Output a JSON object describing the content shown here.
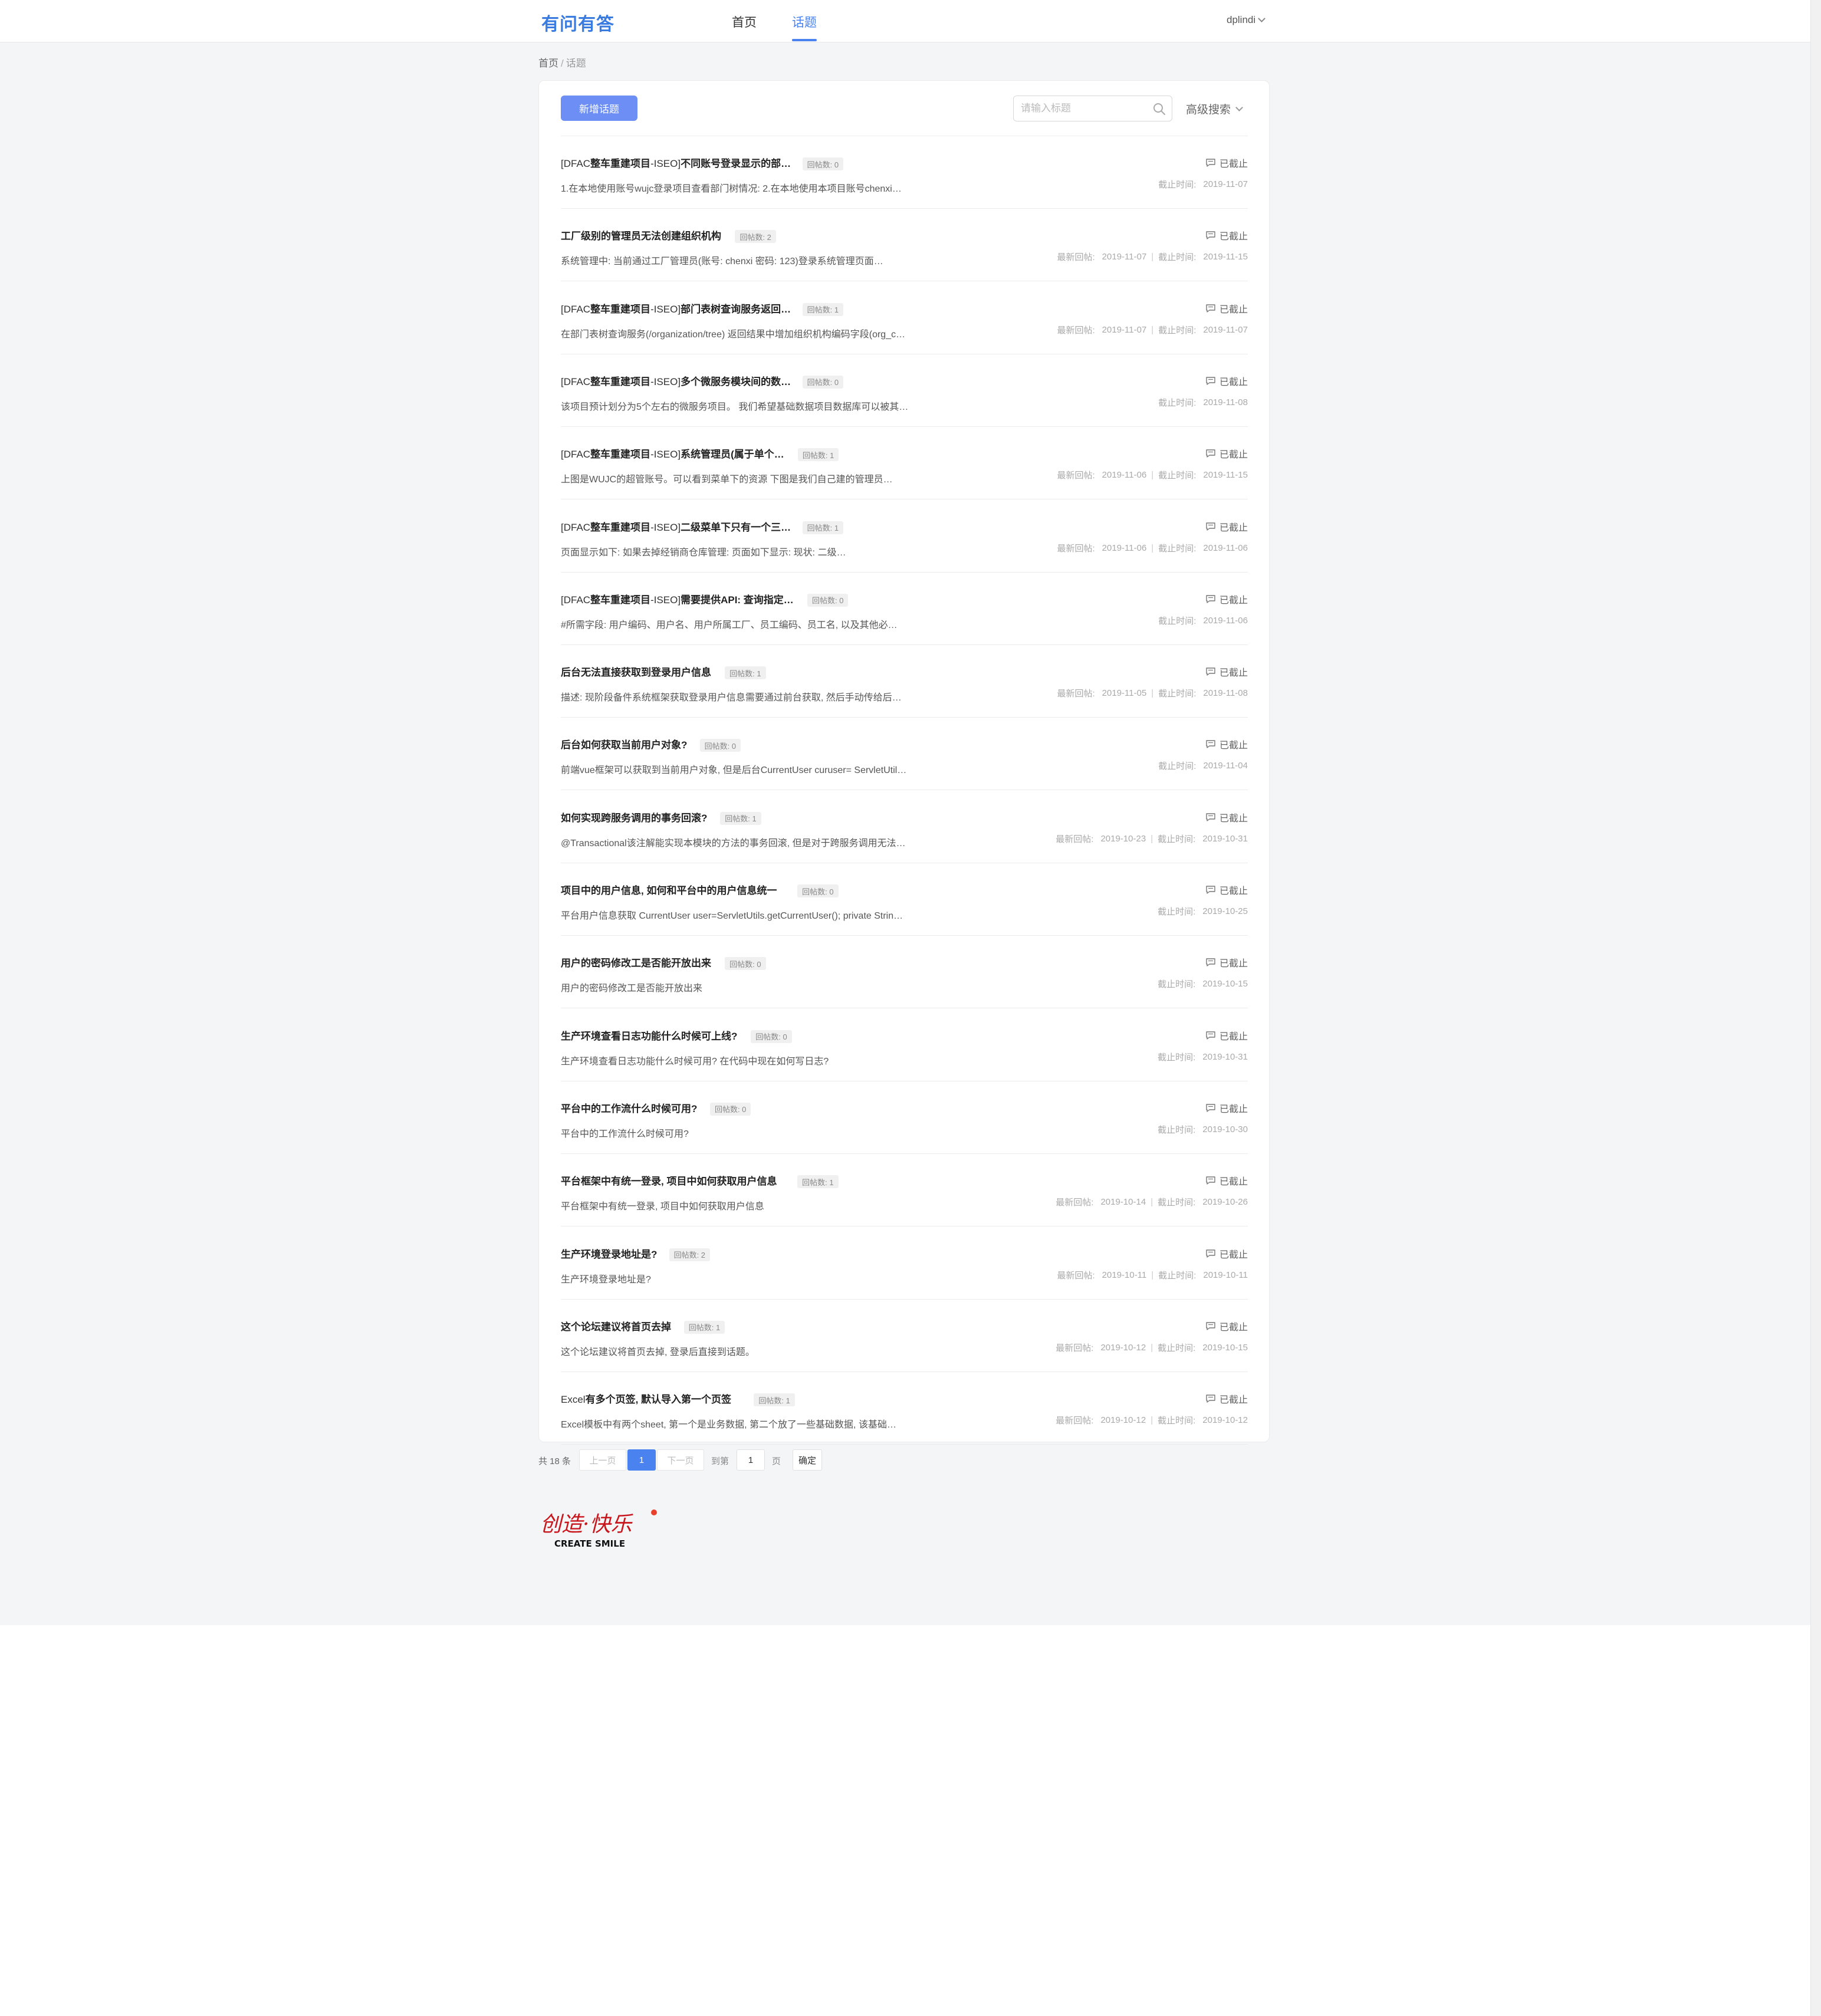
{
  "header": {
    "logo": "有问有答",
    "nav": [
      {
        "label": "首页"
      },
      {
        "label": "话题"
      }
    ],
    "active_nav": "话题",
    "user": "dplindi"
  },
  "breadcrumb": {
    "home": "首页",
    "sep": "/",
    "current": "话题"
  },
  "toolbar": {
    "new_button": "新增话题",
    "search_placeholder": "请输入标题",
    "advanced_search": "高级搜索"
  },
  "labels": {
    "status": "已截止",
    "last_reply": "最新回帖:",
    "deadline": "截止时间:",
    "date_sep": "|"
  },
  "topics": [
    {
      "prefix": "[DFAC",
      "title": "整车重建项目",
      "title_rest": "-ISEO]",
      "title_bold": "不同账号登录显示的部…",
      "replies": "回帖数: 0",
      "desc": "1.在本地使用账号wujc登录项目查看部门树情况: 2.在本地使用本项目账号chenxi…",
      "last_reply": "",
      "deadline": "2019-11-07"
    },
    {
      "prefix": "",
      "title": "",
      "title_rest": "",
      "title_bold": "工厂级别的管理员无法创建组织机构",
      "replies": "回帖数: 2",
      "desc": "系统管理中: 当前通过工厂管理员(账号: chenxi 密码: 123)登录系统管理页面…",
      "last_reply": "2019-11-07",
      "deadline": "2019-11-15"
    },
    {
      "prefix": "[DFAC",
      "title": "整车重建项目",
      "title_rest": "-ISEO]",
      "title_bold": "部门表树查询服务返回…",
      "replies": "回帖数: 1",
      "desc": "在部门表树查询服务(/organization/tree) 返回结果中增加组织机构编码字段(org_c…",
      "last_reply": "2019-11-07",
      "deadline": "2019-11-07"
    },
    {
      "prefix": "[DFAC",
      "title": "整车重建项目",
      "title_rest": "-ISEO]",
      "title_bold": "多个微服务模块间的数…",
      "replies": "回帖数: 0",
      "desc": "该项目预计划分为5个左右的微服务项目。 我们希望基础数据项目数据库可以被其…",
      "last_reply": "",
      "deadline": "2019-11-08"
    },
    {
      "prefix": "[DFAC",
      "title": "整车重建项目",
      "title_rest": "-ISEO]",
      "title_bold": "系统管理员(属于单个…",
      "replies": "回帖数: 1",
      "desc": " 上图是WUJC的超管账号。可以看到菜单下的资源   下图是我们自己建的管理员…",
      "last_reply": "2019-11-06",
      "deadline": "2019-11-15"
    },
    {
      "prefix": "[DFAC",
      "title": "整车重建项目",
      "title_rest": "-ISEO]",
      "title_bold": "二级菜单下只有一个三…",
      "replies": "回帖数: 1",
      "desc": " 页面显示如下:      如果去掉经销商仓库管理:    页面如下显示:    现状: 二级…",
      "last_reply": "2019-11-06",
      "deadline": "2019-11-06"
    },
    {
      "prefix": "[DFAC",
      "title": "整车重建项目",
      "title_rest": "-ISEO]",
      "title_bold": "需要提供API: 查询指定…",
      "replies": "回帖数: 0",
      "desc": "#所需字段: 用户编码、用户名、用户所属工厂、员工编码、员工名, 以及其他必…",
      "last_reply": "",
      "deadline": "2019-11-06"
    },
    {
      "prefix": "",
      "title": "",
      "title_rest": "",
      "title_bold": "后台无法直接获取到登录用户信息",
      "replies": "回帖数: 1",
      "desc": "描述: 现阶段备件系统框架获取登录用户信息需要通过前台获取, 然后手动传给后…",
      "last_reply": "2019-11-05",
      "deadline": "2019-11-08"
    },
    {
      "prefix": "",
      "title": "",
      "title_rest": "",
      "title_bold": "后台如何获取当前用户对象?",
      "replies": "回帖数: 0",
      "desc": "前端vue框架可以获取到当前用户对象, 但是后台CurrentUser curuser= ServletUtil…",
      "last_reply": "",
      "deadline": "2019-11-04"
    },
    {
      "prefix": "",
      "title": "",
      "title_rest": "",
      "title_bold": "如何实现跨服务调用的事务回滚?",
      "replies": "回帖数: 1",
      "desc": "@Transactional该注解能实现本模块的方法的事务回滚, 但是对于跨服务调用无法…",
      "last_reply": "2019-10-23",
      "deadline": "2019-10-31"
    },
    {
      "prefix": "",
      "title": "",
      "title_rest": "",
      "title_bold": "项目中的用户信息, 如何和平台中的用户信息统一",
      "replies": "回帖数: 0",
      "desc": "平台用户信息获取   CurrentUser user=ServletUtils.getCurrentUser();  private Strin…",
      "last_reply": "",
      "deadline": "2019-10-25"
    },
    {
      "prefix": "",
      "title": "",
      "title_rest": "",
      "title_bold": "用户的密码修改工是否能开放出来",
      "replies": "回帖数: 0",
      "desc": "用户的密码修改工是否能开放出来",
      "last_reply": "",
      "deadline": "2019-10-15"
    },
    {
      "prefix": "",
      "title": "",
      "title_rest": "",
      "title_bold": "生产环境查看日志功能什么时候可上线?",
      "replies": "回帖数: 0",
      "desc": "生产环境查看日志功能什么时候可用? 在代码中现在如何写日志?",
      "last_reply": "",
      "deadline": "2019-10-31"
    },
    {
      "prefix": "",
      "title": "",
      "title_rest": "",
      "title_bold": "平台中的工作流什么时候可用?",
      "replies": "回帖数: 0",
      "desc": "平台中的工作流什么时候可用?",
      "last_reply": "",
      "deadline": "2019-10-30"
    },
    {
      "prefix": "",
      "title": "",
      "title_rest": "",
      "title_bold": "平台框架中有统一登录, 项目中如何获取用户信息",
      "replies": "回帖数: 1",
      "desc": "平台框架中有统一登录, 项目中如何获取用户信息",
      "last_reply": "2019-10-14",
      "deadline": "2019-10-26"
    },
    {
      "prefix": "",
      "title": "",
      "title_rest": "",
      "title_bold": "生产环境登录地址是?",
      "replies": "回帖数: 2",
      "desc": "生产环境登录地址是?",
      "last_reply": "2019-10-11",
      "deadline": "2019-10-11"
    },
    {
      "prefix": "",
      "title": "",
      "title_rest": "",
      "title_bold": "这个论坛建议将首页去掉",
      "replies": "回帖数: 1",
      "desc": "这个论坛建议将首页去掉, 登录后直接到话题。",
      "last_reply": "2019-10-12",
      "deadline": "2019-10-15"
    },
    {
      "prefix": "Excel",
      "title": "",
      "title_rest": "",
      "title_bold": "有多个页签, 默认导入第一个页签",
      "replies": "回帖数: 1",
      "desc": "Excel模板中有两个sheet, 第一个是业务数据, 第二个放了一些基础数据, 该基础…",
      "last_reply": "2019-10-12",
      "deadline": "2019-10-12"
    }
  ],
  "pagination": {
    "total": "共 18 条",
    "prev": "上一页",
    "current_page": "1",
    "next": "下一页",
    "goto": "到第",
    "goto_value": "1",
    "page_unit": "页",
    "confirm": "确定"
  },
  "footer": {
    "logo_text": "创造·快乐",
    "logo_sub": "CREATE  SMILE"
  },
  "colors": {
    "accent": "#4a82f0",
    "button": "#6d8ff5",
    "logo": "#3a7be0",
    "footer_logo": "#c8161d"
  }
}
